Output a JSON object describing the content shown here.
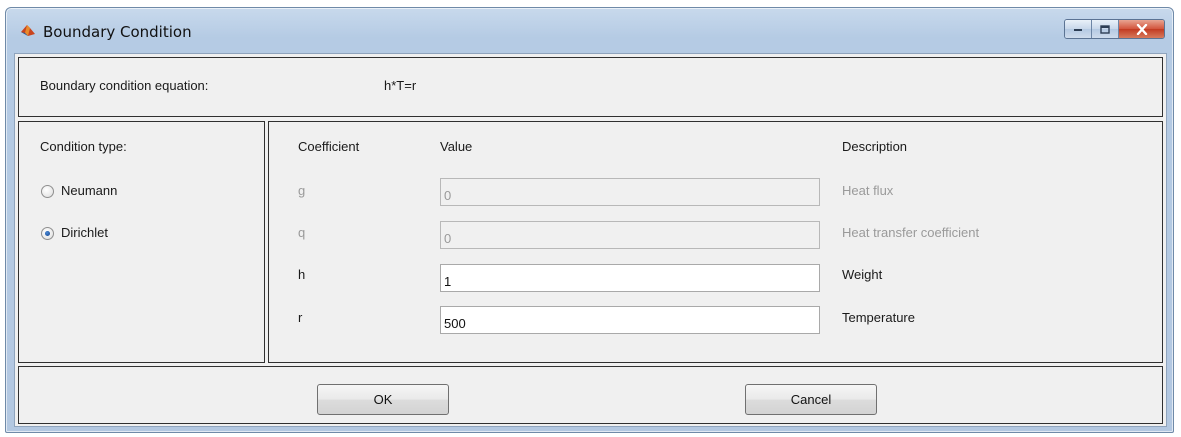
{
  "window": {
    "title": "Boundary Condition",
    "icon": "matlab-icon",
    "controls": [
      "minimize-icon",
      "maximize-icon",
      "close-icon"
    ]
  },
  "equation": {
    "label": "Boundary condition equation:",
    "value": "h*T=r"
  },
  "condition_type": {
    "label": "Condition type:",
    "options": [
      {
        "label": "Neumann",
        "selected": false
      },
      {
        "label": "Dirichlet",
        "selected": true
      }
    ]
  },
  "coefficients": {
    "headers": {
      "coefficient": "Coefficient",
      "value": "Value",
      "description": "Description"
    },
    "rows": [
      {
        "name": "g",
        "value": "0",
        "description": "Heat flux",
        "enabled": false
      },
      {
        "name": "q",
        "value": "0",
        "description": "Heat transfer coefficient",
        "enabled": false
      },
      {
        "name": "h",
        "value": "1",
        "description": "Weight",
        "enabled": true
      },
      {
        "name": "r",
        "value": "500",
        "description": "Temperature",
        "enabled": true
      }
    ]
  },
  "buttons": {
    "ok": "OK",
    "cancel": "Cancel"
  },
  "colors": {
    "titlebar": "#b5cbe4",
    "close_button": "#c23b22",
    "radio_selected": "#0f3f8c",
    "disabled_text": "#9a9a9a"
  }
}
